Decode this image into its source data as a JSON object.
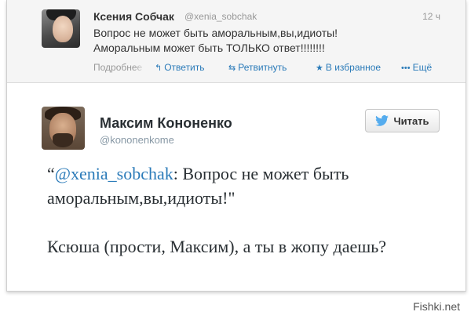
{
  "top_tweet": {
    "name": "Ксения Собчак",
    "handle": "@xenia_sobchak",
    "time": "12 ч",
    "text_line1": "Вопрос не может быть аморальным,вы,идиоты!",
    "text_line2": "Аморальным может быть ТОЛЬКО ответ!!!!!!!!",
    "actions": {
      "details": "Подробнее",
      "reply": "Ответить",
      "retweet": "Ретвитнуть",
      "favorite": "В избранное",
      "more": "Ещё"
    },
    "icons": {
      "reply": "reply-icon",
      "retweet": "retweet-icon",
      "favorite": "star-icon",
      "more": "ellipsis-icon"
    }
  },
  "embedded_tweet": {
    "name": "Максим Кононенко",
    "handle": "@kononenkome",
    "follow_label": "Читать",
    "quote_open": "“",
    "mention": "@xenia_sobchak",
    "quote_rest": ": Вопрос не может быть аморальным,вы,идиоты!\"",
    "reply_text": "Ксюша (прости, Максим), а ты в жопу даешь?"
  },
  "watermark": "Fishki.net",
  "colors": {
    "link": "#2b7bb9",
    "muted": "#999999",
    "text": "#333333",
    "twitter_bird": "#55acee"
  }
}
